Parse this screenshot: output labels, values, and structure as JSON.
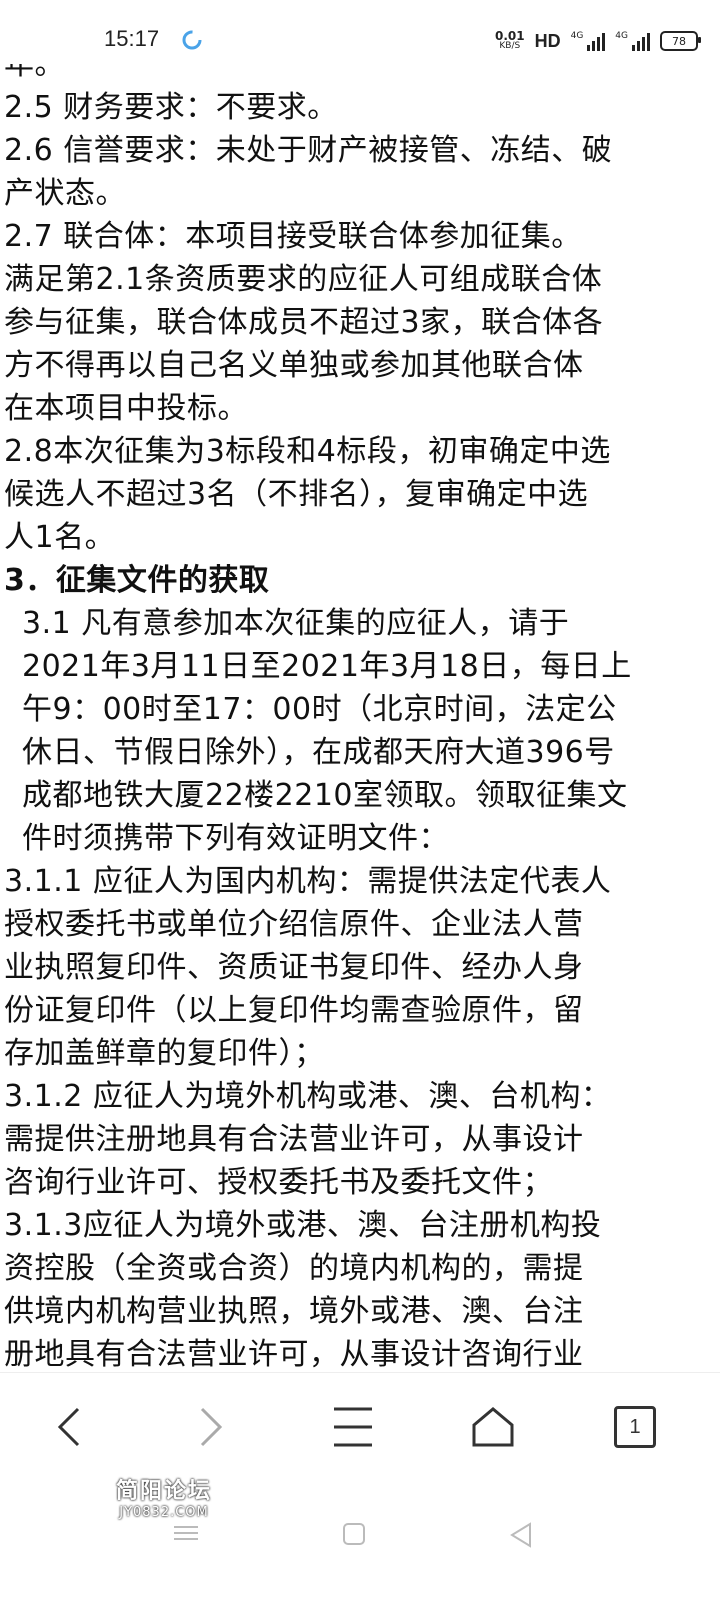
{
  "status_bar": {
    "time": "15:17",
    "net_speed_value": "0.01",
    "net_speed_unit": "KB/S",
    "hd_label": "HD",
    "signal1_label": "4G",
    "signal2_label": "4G",
    "battery": "78"
  },
  "document": {
    "lines": [
      {
        "text": "年。",
        "style": "normal"
      },
      {
        "text": "2.5 财务要求：不要求。",
        "style": "normal"
      },
      {
        "text": "2.6 信誉要求：未处于财产被接管、冻结、破",
        "style": "normal"
      },
      {
        "text": "产状态。",
        "style": "normal"
      },
      {
        "text": "2.7 联合体：本项目接受联合体参加征集。",
        "style": "normal"
      },
      {
        "text": "满足第2.1条资质要求的应征人可组成联合体",
        "style": "normal"
      },
      {
        "text": "参与征集，联合体成员不超过3家，联合体各",
        "style": "normal"
      },
      {
        "text": "方不得再以自己名义单独或参加其他联合体",
        "style": "normal"
      },
      {
        "text": "在本项目中投标。",
        "style": "normal"
      },
      {
        "text": "2.8本次征集为3标段和4标段，初审确定中选",
        "style": "normal"
      },
      {
        "text": "候选人不超过3名（不排名），复审确定中选",
        "style": "normal"
      },
      {
        "text": "人1名。",
        "style": "normal"
      },
      {
        "text": "3．征集文件的获取",
        "style": "bold"
      },
      {
        "text": "3.1 凡有意参加本次征集的应征人，请于",
        "style": "indent"
      },
      {
        "text": "2021年3月11日至2021年3月18日，每日上",
        "style": "indent"
      },
      {
        "text": "午9：00时至17：00时（北京时间，法定公",
        "style": "indent"
      },
      {
        "text": "休日、节假日除外），在成都天府大道396号",
        "style": "indent"
      },
      {
        "text": "成都地铁大厦22楼2210室领取。领取征集文",
        "style": "indent"
      },
      {
        "text": "件时须携带下列有效证明文件：",
        "style": "indent"
      },
      {
        "text": "3.1.1 应征人为国内机构：需提供法定代表人",
        "style": "normal"
      },
      {
        "text": "授权委托书或单位介绍信原件、企业法人营",
        "style": "normal"
      },
      {
        "text": "业执照复印件、资质证书复印件、经办人身",
        "style": "normal"
      },
      {
        "text": "份证复印件（以上复印件均需查验原件，留",
        "style": "normal"
      },
      {
        "text": "存加盖鲜章的复印件）；",
        "style": "normal"
      },
      {
        "text": "3.1.2 应征人为境外机构或港、澳、台机构：",
        "style": "normal"
      },
      {
        "text": "需提供注册地具有合法营业许可，从事设计",
        "style": "normal"
      },
      {
        "text": "咨询行业许可、授权委托书及委托文件；",
        "style": "normal"
      },
      {
        "text": "3.1.3应征人为境外或港、澳、台注册机构投",
        "style": "normal"
      },
      {
        "text": "资控股（全资或合资）的境内机构的，需提",
        "style": "normal"
      },
      {
        "text": "供境内机构营业执照，境外或港、澳、台注",
        "style": "normal"
      },
      {
        "text": "册地具有合法营业许可，从事设计咨询行业",
        "style": "normal"
      }
    ]
  },
  "toolbar": {
    "tab_count": "1"
  },
  "watermark": {
    "line1": "简阳论坛",
    "line2": "JY0832.COM"
  }
}
